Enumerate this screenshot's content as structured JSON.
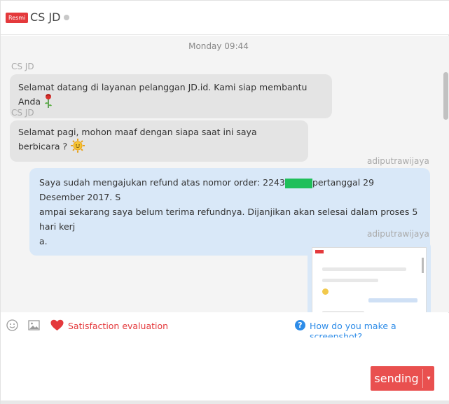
{
  "header": {
    "badge": "Resmi",
    "title": "CS JD"
  },
  "chat": {
    "timestamp": "Monday 09:44",
    "messages": [
      {
        "sender": "CS JD",
        "text": "Selamat datang di layanan pelanggan JD.id. Kami siap membantu Anda"
      },
      {
        "sender": "CS JD",
        "text": "Selamat pagi, mohon maaf dengan siapa saat ini saya berbicara ?"
      },
      {
        "sender": "adiputrawijaya",
        "line1_a": "Saya sudah mengajukan refund atas nomor order: 2243",
        "line1_b": "pertanggal 29 Desember 2017. S",
        "line2": "ampai sekarang saya belum terima refundnya. Dijanjikan akan selesai dalam proses 5 hari kerj",
        "line3": "a."
      },
      {
        "sender": "adiputrawijaya",
        "image": "screenshot-thumbnail"
      }
    ]
  },
  "toolbar": {
    "satisfaction_label": "Satisfaction evaluation",
    "help_label": "How do you make a screenshot?",
    "help_icon_glyph": "?"
  },
  "input": {
    "value": "",
    "placeholder": ""
  },
  "send": {
    "label": "sending",
    "arrow": "▾"
  },
  "colors": {
    "accent_red": "#e4393c",
    "link_blue": "#2d8ce8",
    "incoming_bubble": "#e4e4e4",
    "outgoing_bubble": "#d9e8f8",
    "redaction_green": "#1fbf5a"
  }
}
